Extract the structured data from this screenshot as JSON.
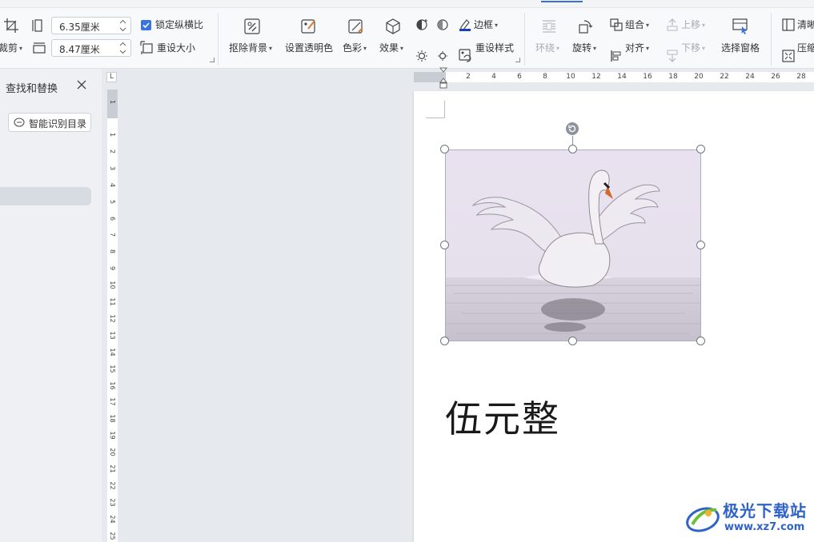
{
  "toolbar": {
    "crop_label": "裁剪",
    "height_value": "6.35厘米",
    "width_value": "8.47厘米",
    "lock_ratio_label": "锁定纵横比",
    "lock_ratio_checked": true,
    "reset_size_label": "重设大小",
    "remove_bg_label": "抠除背景",
    "transparent_color_label": "设置透明色",
    "color_label": "色彩",
    "effects_label": "效果",
    "border_label": "边框",
    "reset_style_label": "重设样式",
    "wrap_label": "环绕",
    "rotate_label": "旋转",
    "group_label": "组合",
    "align_label": "对齐",
    "bring_forward_label": "上移",
    "send_backward_label": "下移",
    "selection_pane_label": "选择窗格",
    "clear_label": "清晰",
    "compress_label": "压缩",
    "accent_color": "#3a73e0",
    "border_swatch_color": "#1f3fb8"
  },
  "nav_pane": {
    "title": "查找和替换",
    "smart_toc_label": "智能识别目录"
  },
  "rulers": {
    "corner_label": "L",
    "horizontal_ticks": [
      "2",
      "4",
      "6",
      "8",
      "10",
      "12",
      "14",
      "16",
      "18",
      "20",
      "22",
      "24",
      "26",
      "28"
    ],
    "vertical_ticks": [
      "1",
      "1",
      "2",
      "3",
      "4",
      "5",
      "6",
      "7",
      "8",
      "9",
      "10",
      "11",
      "12",
      "13",
      "14",
      "15",
      "16",
      "17",
      "18",
      "19",
      "20",
      "21",
      "22",
      "23",
      "24",
      "25"
    ]
  },
  "document": {
    "body_text": "伍元整",
    "image_subject": "swan-photo"
  },
  "watermark": {
    "title": "极光下载站",
    "url": "www.xz7.com",
    "color": "#2f63c8"
  }
}
